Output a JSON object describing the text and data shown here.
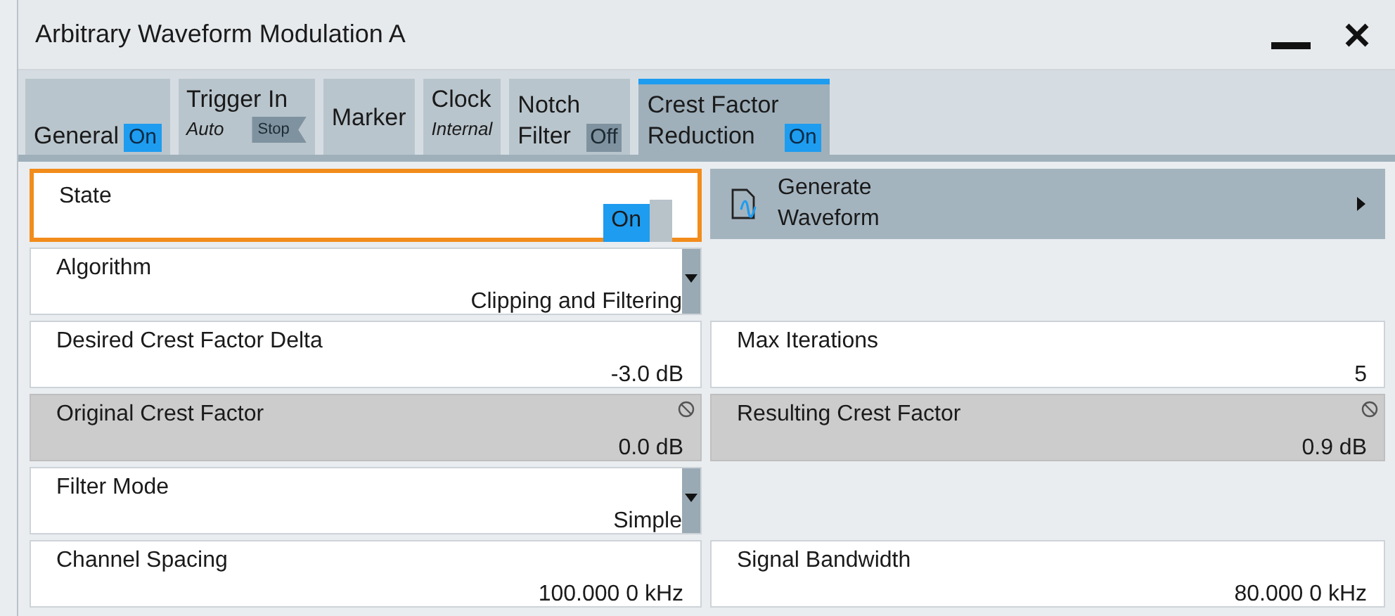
{
  "window": {
    "title": "Arbitrary Waveform Modulation A"
  },
  "tabs": [
    {
      "label": "General",
      "badge": {
        "text": "On",
        "on": true
      },
      "selected": false
    },
    {
      "label": "Trigger In",
      "sublabel": "Auto",
      "badge": {
        "text": "Stop",
        "on": false,
        "kind": "arrow"
      },
      "selected": false
    },
    {
      "label": "Marker",
      "selected": false
    },
    {
      "label": "Clock",
      "sublabel": "Internal",
      "selected": false
    },
    {
      "label": "Notch\nFilter",
      "badge": {
        "text": "Off",
        "on": false
      },
      "selected": false
    },
    {
      "label": "Crest Factor\nReduction",
      "badge": {
        "text": "On",
        "on": true
      },
      "selected": true
    }
  ],
  "rows": [
    [
      {
        "kind": "toggle",
        "label": "State",
        "value": "On",
        "on": true,
        "focused": true
      },
      {
        "kind": "button",
        "label": "Generate\nWaveform"
      }
    ],
    [
      {
        "kind": "dropdown",
        "label": "Algorithm",
        "value": "Clipping and Filtering"
      },
      {
        "kind": "empty"
      }
    ],
    [
      {
        "kind": "value",
        "label": "Desired Crest Factor Delta",
        "value": "-3.0 dB"
      },
      {
        "kind": "value",
        "label": "Max Iterations",
        "value": "5"
      }
    ],
    [
      {
        "kind": "readonly",
        "label": "Original Crest Factor",
        "value": "0.0 dB"
      },
      {
        "kind": "readonly",
        "label": "Resulting Crest Factor",
        "value": "0.9 dB"
      }
    ],
    [
      {
        "kind": "dropdown",
        "label": "Filter Mode",
        "value": "Simple"
      },
      {
        "kind": "empty"
      }
    ],
    [
      {
        "kind": "value",
        "label": "Channel Spacing",
        "value": "100.000 0 kHz"
      },
      {
        "kind": "value",
        "label": "Signal Bandwidth",
        "value": "80.000 0 kHz"
      }
    ]
  ]
}
